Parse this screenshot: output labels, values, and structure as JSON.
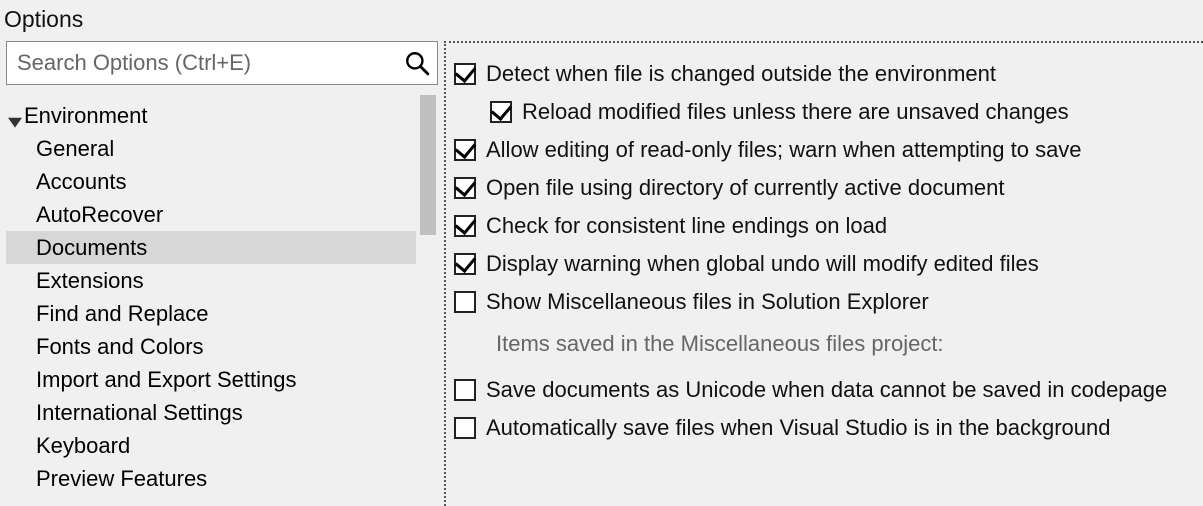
{
  "window": {
    "title": "Options"
  },
  "search": {
    "placeholder": "Search Options (Ctrl+E)"
  },
  "tree": {
    "category": "Environment",
    "items": [
      {
        "label": "General"
      },
      {
        "label": "Accounts"
      },
      {
        "label": "AutoRecover"
      },
      {
        "label": "Documents",
        "selected": true
      },
      {
        "label": "Extensions"
      },
      {
        "label": "Find and Replace"
      },
      {
        "label": "Fonts and Colors"
      },
      {
        "label": "Import and Export Settings"
      },
      {
        "label": "International Settings"
      },
      {
        "label": "Keyboard"
      },
      {
        "label": "Preview Features"
      }
    ]
  },
  "options": {
    "detectChange": {
      "label": "Detect when file is changed outside the environment",
      "checked": true
    },
    "reloadModified": {
      "label": "Reload modified files unless there are unsaved changes",
      "checked": true
    },
    "allowReadonly": {
      "label": "Allow editing of read-only files; warn when attempting to save",
      "checked": true
    },
    "openActiveDir": {
      "label": "Open file using directory of currently active document",
      "checked": true
    },
    "checkLineEndings": {
      "label": "Check for consistent line endings on load",
      "checked": true
    },
    "globalUndoWarn": {
      "label": "Display warning when global undo will modify edited files",
      "checked": true
    },
    "showMiscFiles": {
      "label": "Show Miscellaneous files in Solution Explorer",
      "checked": false
    },
    "miscNote": "Items saved in the Miscellaneous files project:",
    "saveUnicode": {
      "label": "Save documents as Unicode when data cannot be saved in codepage",
      "checked": false
    },
    "autosaveBg": {
      "label": "Automatically save files when Visual Studio is in the background",
      "checked": false
    }
  }
}
